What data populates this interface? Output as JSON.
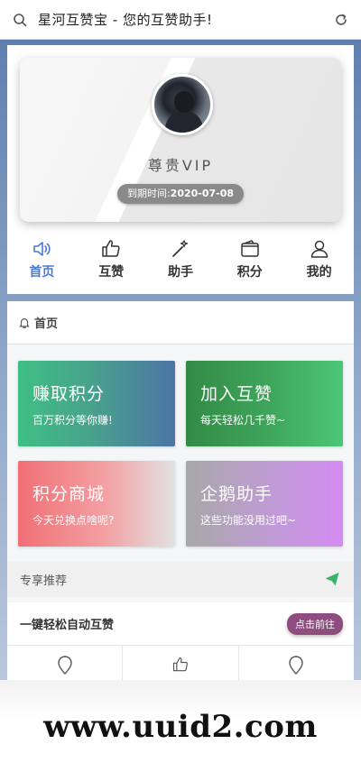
{
  "browser": {
    "title": "星河互赞宝 - 您的互赞助手!",
    "icons": {
      "search": "search-icon",
      "refresh": "refresh-icon"
    }
  },
  "profile": {
    "vip_label": "尊贵VIP",
    "expire_prefix": "到期时间:",
    "expire_date": "2020-07-08"
  },
  "nav": {
    "items": [
      {
        "label": "首页",
        "icon": "speaker-icon",
        "active": true
      },
      {
        "label": "互赞",
        "icon": "thumbs-up-icon",
        "active": false
      },
      {
        "label": "助手",
        "icon": "magic-wand-icon",
        "active": false
      },
      {
        "label": "积分",
        "icon": "wallet-icon",
        "active": false
      },
      {
        "label": "我的",
        "icon": "user-icon",
        "active": false
      }
    ]
  },
  "section": {
    "title": "首页",
    "icon": "bell-icon"
  },
  "tiles": [
    {
      "title": "赚取积分",
      "subtitle": "百万积分等你赚!"
    },
    {
      "title": "加入互赞",
      "subtitle": "每天轻松几千赞~"
    },
    {
      "title": "积分商城",
      "subtitle": "今天兑换点啥呢?"
    },
    {
      "title": "企鹅助手",
      "subtitle": "这些功能没用过吧~"
    }
  ],
  "recommend": {
    "label": "专享推荐",
    "icon": "send-icon"
  },
  "auto_like": {
    "label": "一键轻松自动互赞",
    "button": "点击前往"
  },
  "watermark": "www.uuid2.com",
  "colors": {
    "accent": "#4a7bd0",
    "go_button": "#8e4d7e",
    "send_icon": "#3db36b"
  }
}
